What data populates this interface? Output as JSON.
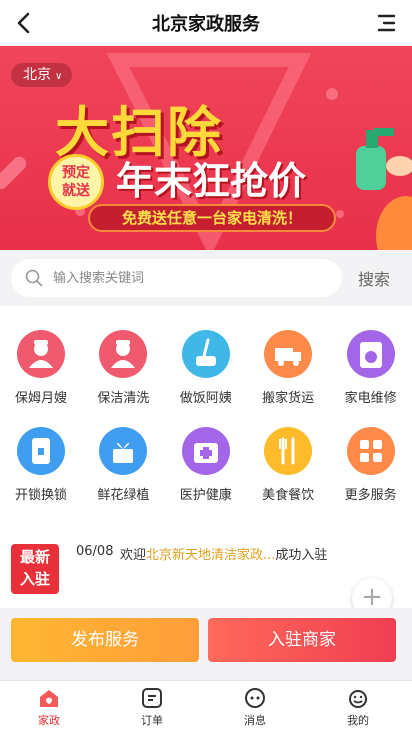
{
  "header": {
    "title": "北京家政服务"
  },
  "banner": {
    "city": "北京",
    "headline": "大扫除",
    "subheadline": "年末狂抢价",
    "badge_line1": "预定",
    "badge_line2": "就送",
    "strip": "免费送任意一台家电清洗！"
  },
  "search": {
    "placeholder": "输入搜索关键词",
    "button": "搜索"
  },
  "services": [
    {
      "label": "保姆月嫂",
      "color": "#ef5a6e",
      "icon": "nanny-icon"
    },
    {
      "label": "保洁清洗",
      "color": "#ef5a6e",
      "icon": "cleaner-icon"
    },
    {
      "label": "做饭阿姨",
      "color": "#3fb8e8",
      "icon": "cooking-icon"
    },
    {
      "label": "搬家货运",
      "color": "#ff8a4a",
      "icon": "truck-icon"
    },
    {
      "label": "家电维修",
      "color": "#a366e8",
      "icon": "washer-icon"
    },
    {
      "label": "开锁换锁",
      "color": "#3f9ef0",
      "icon": "lock-icon"
    },
    {
      "label": "鲜花绿植",
      "color": "#3f9ef0",
      "icon": "flower-icon"
    },
    {
      "label": "医护健康",
      "color": "#a366e8",
      "icon": "medical-icon"
    },
    {
      "label": "美食餐饮",
      "color": "#ffbb2a",
      "icon": "food-icon"
    },
    {
      "label": "更多服务",
      "color": "#ff8a4a",
      "icon": "more-icon"
    }
  ],
  "notice": {
    "tag_line1": "最新",
    "tag_line2": "入驻",
    "date": "06/08",
    "prefix": "欢迎",
    "highlight": "北京新天地清洁家政...",
    "suffix": "成功入驻"
  },
  "actions": {
    "publish": "发布服务",
    "join": "入驻商家"
  },
  "tabbar": [
    {
      "label": "家政",
      "icon": "home-icon",
      "active": true
    },
    {
      "label": "订单",
      "icon": "order-icon",
      "active": false
    },
    {
      "label": "消息",
      "icon": "message-icon",
      "active": false
    },
    {
      "label": "我的",
      "icon": "profile-icon",
      "active": false
    }
  ],
  "colors": {
    "brand_red": "#e8303a",
    "accent_yellow": "#ffd93a"
  }
}
